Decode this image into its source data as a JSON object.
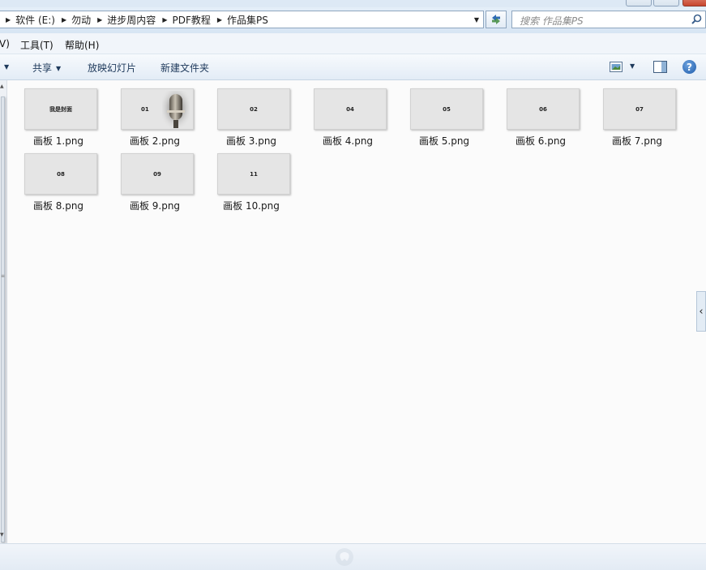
{
  "breadcrumb": [
    "软件 (E:)",
    "勿动",
    "进步周内容",
    "PDF教程",
    "作品集PS"
  ],
  "search": {
    "placeholder": "搜索 作品集PS"
  },
  "menu": {
    "view_partial": "V)",
    "tools": "工具(T)",
    "help": "帮助(H)"
  },
  "toolbar": {
    "share": "共享",
    "slideshow": "放映幻灯片",
    "new_folder": "新建文件夹",
    "help_glyph": "?"
  },
  "files": [
    {
      "name": "画板 1.png",
      "thumb_text": "我是封面"
    },
    {
      "name": "画板 2.png",
      "thumb_text": "01"
    },
    {
      "name": "画板 3.png",
      "thumb_text": "02"
    },
    {
      "name": "画板 4.png",
      "thumb_text": "04"
    },
    {
      "name": "画板 5.png",
      "thumb_text": "05"
    },
    {
      "name": "画板 6.png",
      "thumb_text": "06"
    },
    {
      "name": "画板 7.png",
      "thumb_text": "07"
    },
    {
      "name": "画板 8.png",
      "thumb_text": "08"
    },
    {
      "name": "画板 9.png",
      "thumb_text": "09"
    },
    {
      "name": "画板 10.png",
      "thumb_text": "11"
    }
  ],
  "colors": {
    "toolbar_text": "#1e395b",
    "content_bg": "#fbfbfb",
    "thumb_bg": "#e5e5e5",
    "help_blue": "#1e5cab"
  }
}
